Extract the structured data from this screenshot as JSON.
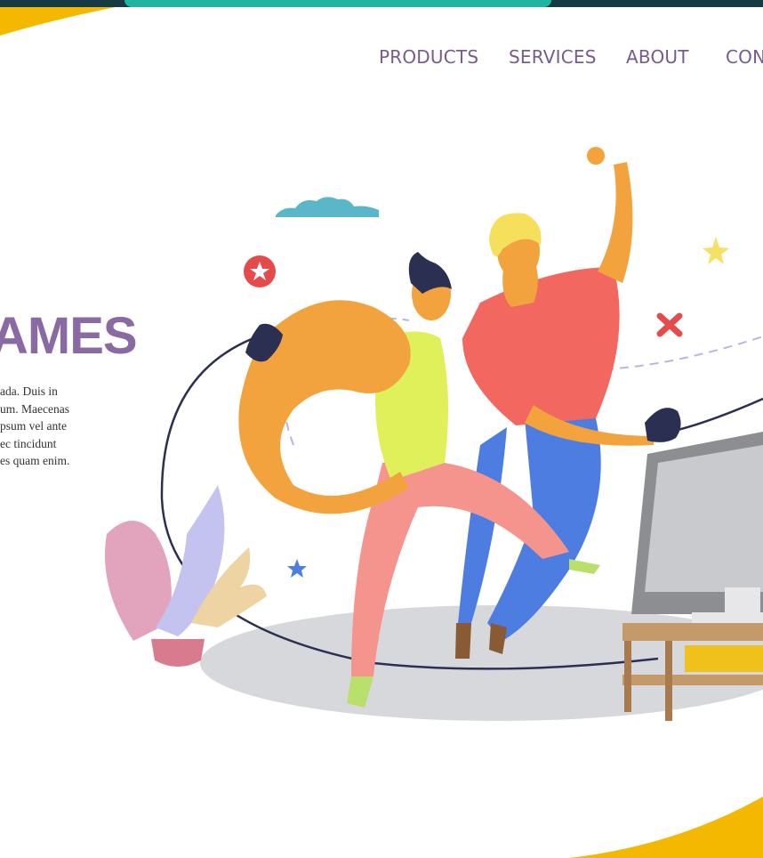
{
  "nav": {
    "items": [
      "PRODUCTS",
      "SERVICES",
      "ABOUT",
      "CON"
    ]
  },
  "hero": {
    "title": "AMES",
    "text_lines": [
      "ada. Duis in",
      "um. Maecenas",
      "psum vel ante",
      "ec tincidunt",
      "es quam enim."
    ]
  },
  "colors": {
    "accent_purple": "#8a6aa2",
    "nav_purple": "#7a5a8f",
    "yellow": "#f5b800",
    "teal": "#23b3a3",
    "dark_teal": "#163a42"
  }
}
